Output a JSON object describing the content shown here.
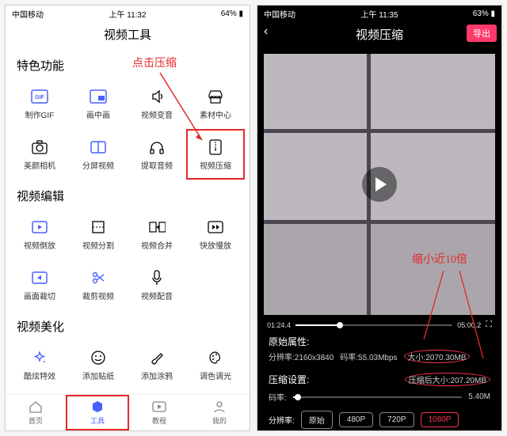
{
  "left": {
    "status": {
      "carrier": "中国移动",
      "time": "上午 11:32",
      "battery": "64%"
    },
    "title": "视频工具",
    "sections": {
      "special": {
        "title": "特色功能",
        "tiles": [
          {
            "label": "制作GIF"
          },
          {
            "label": "画中画"
          },
          {
            "label": "视频变音"
          },
          {
            "label": "素材中心"
          },
          {
            "label": "美颜相机"
          },
          {
            "label": "分屏视频"
          },
          {
            "label": "提取音频"
          },
          {
            "label": "视频压缩"
          }
        ]
      },
      "edit": {
        "title": "视频编辑",
        "tiles": [
          {
            "label": "视频倒放"
          },
          {
            "label": "视频分割"
          },
          {
            "label": "视频合并"
          },
          {
            "label": "快放慢放"
          },
          {
            "label": "画面裁切"
          },
          {
            "label": "裁剪视频"
          },
          {
            "label": "视频配音"
          }
        ]
      },
      "beautify": {
        "title": "视频美化",
        "tiles": [
          {
            "label": "酷炫特效"
          },
          {
            "label": "添加贴纸"
          },
          {
            "label": "添加涂鸦"
          },
          {
            "label": "调色调光"
          }
        ]
      }
    },
    "nav": [
      {
        "label": "首页"
      },
      {
        "label": "工具"
      },
      {
        "label": "教程"
      },
      {
        "label": "我的"
      }
    ],
    "anno": {
      "click_compress": "点击压缩"
    }
  },
  "right": {
    "status": {
      "carrier": "中国移动",
      "time": "上午 11:35",
      "battery": "63%"
    },
    "title": "视频压缩",
    "export": "导出",
    "timeline": {
      "current": "01:24.4",
      "total": "05:00.2"
    },
    "orig": {
      "header": "原始属性:",
      "res": "分辨率:2160x3840",
      "bitrate": "码率:55.03Mbps",
      "size": "大小:2070.30MB"
    },
    "comp": {
      "header": "压缩设置:",
      "size": "压缩后大小:207.20MB"
    },
    "bitrate": {
      "label": "码率:",
      "value": "5.40M"
    },
    "res_row": {
      "label": "分辨率:",
      "opts": [
        "原始",
        "480P",
        "720P",
        "1080P"
      ]
    },
    "anno": {
      "shrink": "缩小近10倍"
    }
  }
}
